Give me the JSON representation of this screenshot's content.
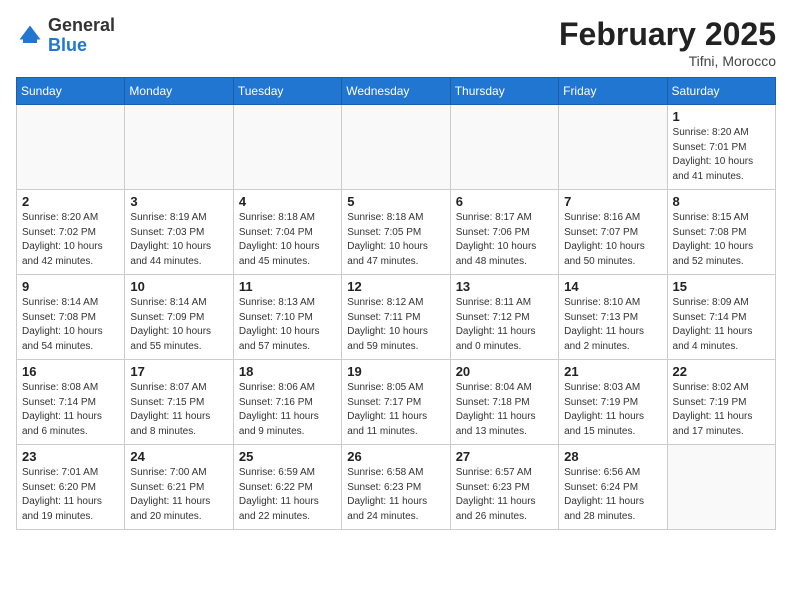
{
  "header": {
    "logo_general": "General",
    "logo_blue": "Blue",
    "month_year": "February 2025",
    "location": "Tifni, Morocco"
  },
  "days_of_week": [
    "Sunday",
    "Monday",
    "Tuesday",
    "Wednesday",
    "Thursday",
    "Friday",
    "Saturday"
  ],
  "weeks": [
    [
      {
        "day": "",
        "info": ""
      },
      {
        "day": "",
        "info": ""
      },
      {
        "day": "",
        "info": ""
      },
      {
        "day": "",
        "info": ""
      },
      {
        "day": "",
        "info": ""
      },
      {
        "day": "",
        "info": ""
      },
      {
        "day": "1",
        "info": "Sunrise: 8:20 AM\nSunset: 7:01 PM\nDaylight: 10 hours and 41 minutes."
      }
    ],
    [
      {
        "day": "2",
        "info": "Sunrise: 8:20 AM\nSunset: 7:02 PM\nDaylight: 10 hours and 42 minutes."
      },
      {
        "day": "3",
        "info": "Sunrise: 8:19 AM\nSunset: 7:03 PM\nDaylight: 10 hours and 44 minutes."
      },
      {
        "day": "4",
        "info": "Sunrise: 8:18 AM\nSunset: 7:04 PM\nDaylight: 10 hours and 45 minutes."
      },
      {
        "day": "5",
        "info": "Sunrise: 8:18 AM\nSunset: 7:05 PM\nDaylight: 10 hours and 47 minutes."
      },
      {
        "day": "6",
        "info": "Sunrise: 8:17 AM\nSunset: 7:06 PM\nDaylight: 10 hours and 48 minutes."
      },
      {
        "day": "7",
        "info": "Sunrise: 8:16 AM\nSunset: 7:07 PM\nDaylight: 10 hours and 50 minutes."
      },
      {
        "day": "8",
        "info": "Sunrise: 8:15 AM\nSunset: 7:08 PM\nDaylight: 10 hours and 52 minutes."
      }
    ],
    [
      {
        "day": "9",
        "info": "Sunrise: 8:14 AM\nSunset: 7:08 PM\nDaylight: 10 hours and 54 minutes."
      },
      {
        "day": "10",
        "info": "Sunrise: 8:14 AM\nSunset: 7:09 PM\nDaylight: 10 hours and 55 minutes."
      },
      {
        "day": "11",
        "info": "Sunrise: 8:13 AM\nSunset: 7:10 PM\nDaylight: 10 hours and 57 minutes."
      },
      {
        "day": "12",
        "info": "Sunrise: 8:12 AM\nSunset: 7:11 PM\nDaylight: 10 hours and 59 minutes."
      },
      {
        "day": "13",
        "info": "Sunrise: 8:11 AM\nSunset: 7:12 PM\nDaylight: 11 hours and 0 minutes."
      },
      {
        "day": "14",
        "info": "Sunrise: 8:10 AM\nSunset: 7:13 PM\nDaylight: 11 hours and 2 minutes."
      },
      {
        "day": "15",
        "info": "Sunrise: 8:09 AM\nSunset: 7:14 PM\nDaylight: 11 hours and 4 minutes."
      }
    ],
    [
      {
        "day": "16",
        "info": "Sunrise: 8:08 AM\nSunset: 7:14 PM\nDaylight: 11 hours and 6 minutes."
      },
      {
        "day": "17",
        "info": "Sunrise: 8:07 AM\nSunset: 7:15 PM\nDaylight: 11 hours and 8 minutes."
      },
      {
        "day": "18",
        "info": "Sunrise: 8:06 AM\nSunset: 7:16 PM\nDaylight: 11 hours and 9 minutes."
      },
      {
        "day": "19",
        "info": "Sunrise: 8:05 AM\nSunset: 7:17 PM\nDaylight: 11 hours and 11 minutes."
      },
      {
        "day": "20",
        "info": "Sunrise: 8:04 AM\nSunset: 7:18 PM\nDaylight: 11 hours and 13 minutes."
      },
      {
        "day": "21",
        "info": "Sunrise: 8:03 AM\nSunset: 7:19 PM\nDaylight: 11 hours and 15 minutes."
      },
      {
        "day": "22",
        "info": "Sunrise: 8:02 AM\nSunset: 7:19 PM\nDaylight: 11 hours and 17 minutes."
      }
    ],
    [
      {
        "day": "23",
        "info": "Sunrise: 7:01 AM\nSunset: 6:20 PM\nDaylight: 11 hours and 19 minutes."
      },
      {
        "day": "24",
        "info": "Sunrise: 7:00 AM\nSunset: 6:21 PM\nDaylight: 11 hours and 20 minutes."
      },
      {
        "day": "25",
        "info": "Sunrise: 6:59 AM\nSunset: 6:22 PM\nDaylight: 11 hours and 22 minutes."
      },
      {
        "day": "26",
        "info": "Sunrise: 6:58 AM\nSunset: 6:23 PM\nDaylight: 11 hours and 24 minutes."
      },
      {
        "day": "27",
        "info": "Sunrise: 6:57 AM\nSunset: 6:23 PM\nDaylight: 11 hours and 26 minutes."
      },
      {
        "day": "28",
        "info": "Sunrise: 6:56 AM\nSunset: 6:24 PM\nDaylight: 11 hours and 28 minutes."
      },
      {
        "day": "",
        "info": ""
      }
    ]
  ]
}
